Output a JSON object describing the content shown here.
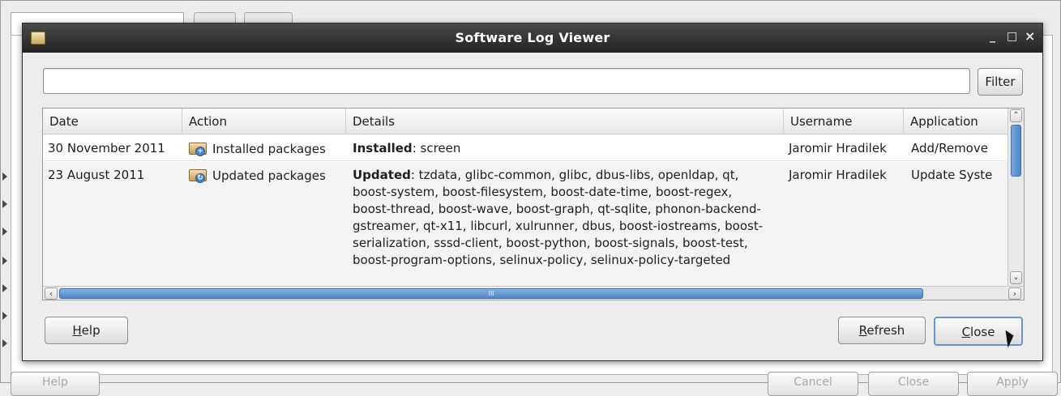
{
  "dialog": {
    "title": "Software Log Viewer",
    "controls": {
      "minimize": "_",
      "maximize": "□",
      "close": "×"
    }
  },
  "filter": {
    "value": "",
    "placeholder": "",
    "button_label": "Filter"
  },
  "table": {
    "columns": [
      "Date",
      "Action",
      "Details",
      "Username",
      "Application"
    ],
    "rows": [
      {
        "date": "30 November 2011",
        "action_icon": "package-install-icon",
        "action": "Installed packages",
        "details_prefix": "Installed",
        "details_text": ": screen",
        "username": "Jaromir Hradilek",
        "application": "Add/Remove"
      },
      {
        "date": "23 August 2011",
        "action_icon": "package-update-icon",
        "action": "Updated packages",
        "details_prefix": "Updated",
        "details_text": ": tzdata, glibc-common, glibc, dbus-libs, openldap, qt, boost-system, boost-filesystem, boost-date-time, boost-regex, boost-thread, boost-wave, boost-graph, qt-sqlite, phonon-backend-gstreamer, qt-x11, libcurl, xulrunner, dbus, boost-iostreams, boost-serialization, sssd-client, boost-python, boost-signals, boost-test, boost-program-options, selinux-policy, selinux-policy-targeted",
        "username": "Jaromir Hradilek",
        "application": "Update Syste"
      }
    ]
  },
  "buttons": {
    "help_first": "H",
    "help_rest": "elp",
    "refresh_first": "R",
    "refresh_rest": "efresh",
    "close_first": "C",
    "close_rest": "lose"
  },
  "background": {
    "bottom_buttons": [
      "Help",
      "Cancel",
      "Close",
      "Apply"
    ]
  },
  "colors": {
    "accent": "#4f86c8",
    "titlebar": "#2a2a2a"
  }
}
